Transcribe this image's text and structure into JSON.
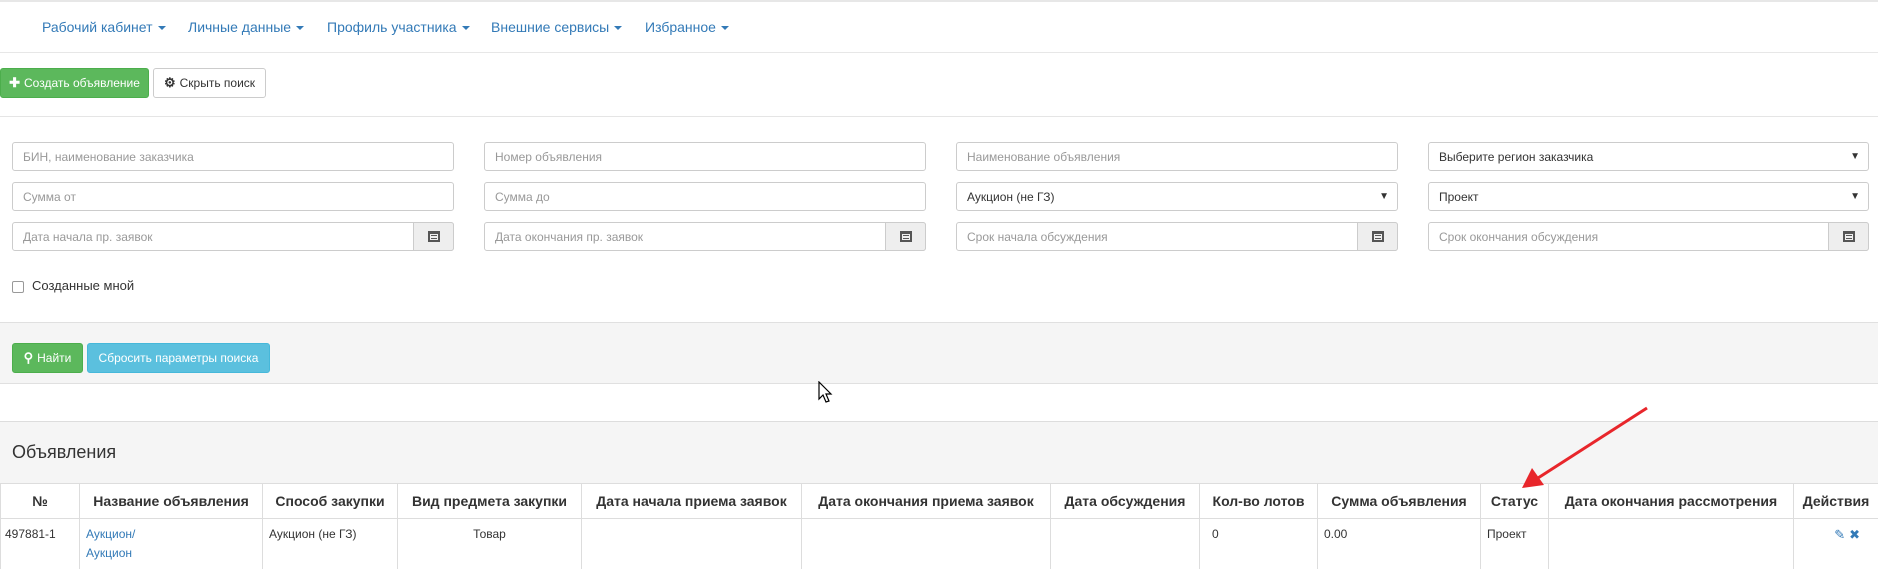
{
  "nav": {
    "items": [
      "Рабочий кабинет",
      "Личные данные",
      "Профиль участника",
      "Внешние сервисы",
      "Избранное"
    ]
  },
  "toolbar": {
    "create_label": "Создать объявление",
    "hide_search_label": "Скрыть поиск"
  },
  "filters": {
    "bin_placeholder": "БИН, наименование заказчика",
    "number_placeholder": "Номер объявления",
    "name_placeholder": "Наименование объявления",
    "region_value": "Выберите регион заказчика",
    "sum_from_placeholder": "Сумма от",
    "sum_to_placeholder": "Сумма до",
    "method_value": "Аукцион (не ГЗ)",
    "status_value": "Проект",
    "start_date_placeholder": "Дата начала пр. заявок",
    "end_date_placeholder": "Дата окончания пр. заявок",
    "discussion_start_placeholder": "Срок начала обсуждения",
    "discussion_end_placeholder": "Срок окончания обсуждения",
    "created_by_me_label": "Созданные мной"
  },
  "search": {
    "find_label": "Найти",
    "reset_label": "Сбросить параметры поиска"
  },
  "panel": {
    "title": "Объявления"
  },
  "table": {
    "headers": [
      "№",
      "Название объявления",
      "Способ закупки",
      "Вид предмета закупки",
      "Дата начала приема заявок",
      "Дата окончания приема заявок",
      "Дата обсуждения",
      "Кол-во лотов",
      "Сумма объявления",
      "Статус",
      "Дата окончания рассмотрения",
      "Действия"
    ],
    "rows": [
      {
        "number": "497881-1",
        "name_line1": "Аукцион/",
        "name_line2": "Аукцион",
        "method": "Аукцион (не ГЗ)",
        "subject": "Товар",
        "start_date": "",
        "end_date": "",
        "discussion_date": "",
        "lots": "0",
        "sum": "0.00",
        "status": "Проект",
        "review_end_date": ""
      }
    ]
  },
  "colors": {
    "link": "#337ab7",
    "success": "#5cb85c",
    "info": "#5bc0de",
    "annotation_arrow": "#e8262b"
  }
}
